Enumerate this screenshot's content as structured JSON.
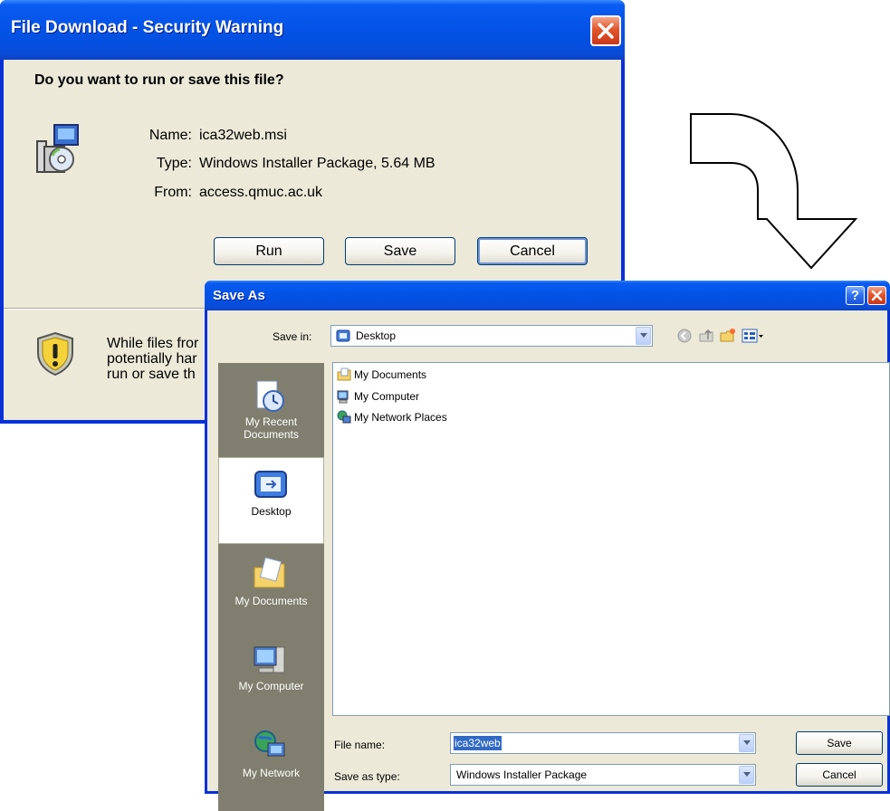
{
  "download_dialog": {
    "title": "File Download - Security Warning",
    "question": "Do you want to run or save this file?",
    "name_label": "Name:",
    "name_value": "ica32web.msi",
    "type_label": "Type:",
    "type_value": "Windows Installer Package, 5.64 MB",
    "from_label": "From:",
    "from_value": "access.qmuc.ac.uk",
    "run_button": "Run",
    "save_button": "Save",
    "cancel_button": "Cancel",
    "warning_line1": "While files fror",
    "warning_line2": "potentially har",
    "warning_line3": "run or save th"
  },
  "save_as_dialog": {
    "title": "Save As",
    "help_button": "?",
    "save_in_label": "Save in:",
    "save_in_value": "Desktop",
    "places": [
      {
        "label": "My Recent Documents",
        "icon": "recent-documents-icon"
      },
      {
        "label": "Desktop",
        "icon": "desktop-icon"
      },
      {
        "label": "My Documents",
        "icon": "my-documents-icon"
      },
      {
        "label": "My Computer",
        "icon": "my-computer-icon"
      },
      {
        "label": "My Network",
        "icon": "my-network-icon"
      }
    ],
    "files": [
      {
        "name": "My Documents",
        "icon": "folder-icon"
      },
      {
        "name": "My Computer",
        "icon": "computer-icon"
      },
      {
        "name": "My Network Places",
        "icon": "network-icon"
      }
    ],
    "file_name_label": "File name:",
    "file_name_value": "ica32web",
    "save_as_type_label": "Save as type:",
    "save_as_type_value": "Windows Installer Package",
    "save_button": "Save",
    "cancel_button": "Cancel"
  },
  "colors": {
    "title_bar": "#0454e8",
    "dialog_face": "#ece9d8",
    "selection": "#316ac5"
  }
}
